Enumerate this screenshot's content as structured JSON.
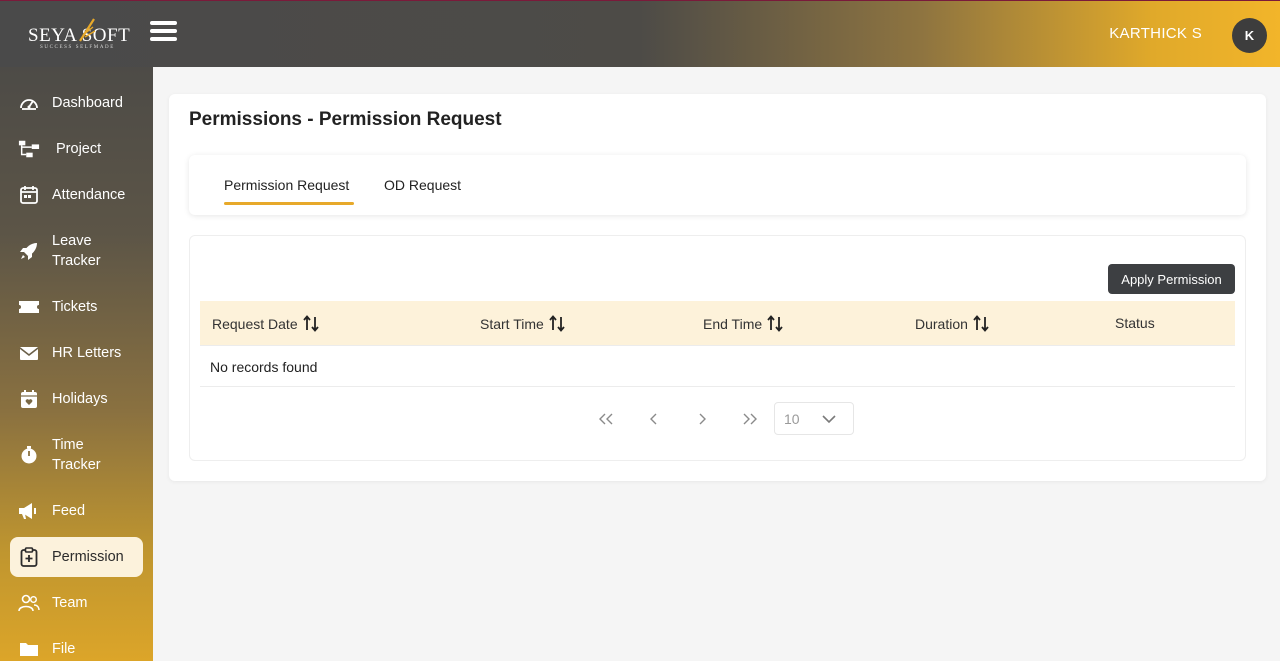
{
  "header": {
    "logo_text": "SEYA SOFT",
    "logo_tagline": "SUCCESS SELFMADE",
    "user_name": "KARTHICK S",
    "avatar_initial": "K"
  },
  "sidebar": {
    "items": [
      {
        "label": "Dashboard",
        "icon": "dashboard-icon"
      },
      {
        "label": "Project",
        "icon": "project-icon"
      },
      {
        "label": "Attendance",
        "icon": "calendar-icon"
      },
      {
        "label": "Leave Tracker",
        "icon": "rocket-icon"
      },
      {
        "label": "Tickets",
        "icon": "ticket-icon"
      },
      {
        "label": "HR Letters",
        "icon": "mail-icon"
      },
      {
        "label": "Holidays",
        "icon": "calendar-heart-icon"
      },
      {
        "label": "Time Tracker",
        "icon": "stopwatch-icon"
      },
      {
        "label": "Feed",
        "icon": "megaphone-icon"
      },
      {
        "label": "Permission",
        "icon": "clipboard-plus-icon",
        "active": true
      },
      {
        "label": "Team",
        "icon": "team-icon"
      },
      {
        "label": "File",
        "icon": "folder-icon"
      }
    ]
  },
  "main": {
    "title": "Permissions - Permission Request",
    "tabs": [
      {
        "label": "Permission Request",
        "active": true
      },
      {
        "label": "OD Request",
        "active": false
      }
    ],
    "apply_button": "Apply Permission",
    "table": {
      "columns": [
        "Request Date",
        "Start Time",
        "End Time",
        "Duration",
        "Status"
      ],
      "empty_message": "No records found"
    },
    "pagination": {
      "rows_per_page": "10"
    }
  },
  "colors": {
    "accent": "#e7a92a",
    "header_dark": "#4a4a4a",
    "table_header_bg": "#fdf2da",
    "button_dark": "#3d3f42"
  }
}
